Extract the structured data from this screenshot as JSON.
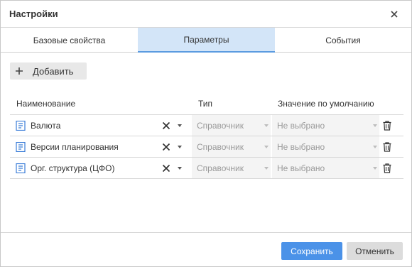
{
  "dialog": {
    "title": "Настройки"
  },
  "tabs": [
    {
      "label": "Базовые свойства",
      "active": false
    },
    {
      "label": "Параметры",
      "active": true
    },
    {
      "label": "События",
      "active": false
    }
  ],
  "toolbar": {
    "add_label": "Добавить"
  },
  "table": {
    "columns": [
      "Наименование",
      "Тип",
      "Значение по умолчанию"
    ],
    "rows": [
      {
        "name": "Валюта",
        "type": "Справочник",
        "default": "Не выбрано"
      },
      {
        "name": "Версии планирования",
        "type": "Справочник",
        "default": "Не выбрано"
      },
      {
        "name": "Орг. структура (ЦФО)",
        "type": "Справочник",
        "default": "Не выбрано"
      }
    ]
  },
  "footer": {
    "save_label": "Сохранить",
    "cancel_label": "Отменить"
  },
  "colors": {
    "accent": "#4b92e8",
    "active_tab": "#d3e5f8",
    "doc_icon": "#3b7dd8"
  }
}
